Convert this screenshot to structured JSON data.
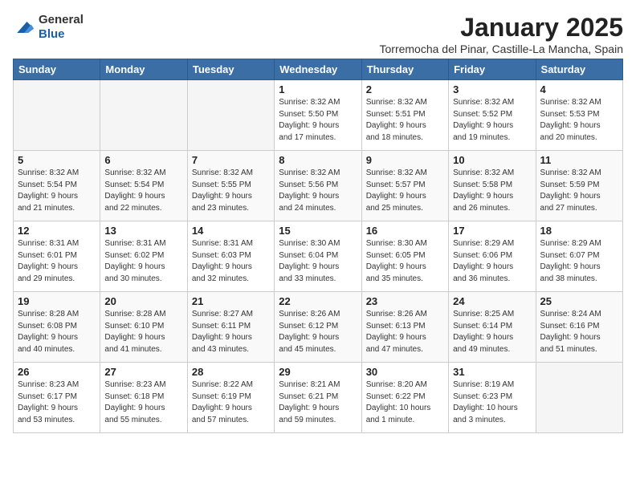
{
  "header": {
    "logo_line1": "General",
    "logo_line2": "Blue",
    "month": "January 2025",
    "location": "Torremocha del Pinar, Castille-La Mancha, Spain"
  },
  "weekdays": [
    "Sunday",
    "Monday",
    "Tuesday",
    "Wednesday",
    "Thursday",
    "Friday",
    "Saturday"
  ],
  "weeks": [
    [
      {
        "day": "",
        "info": ""
      },
      {
        "day": "",
        "info": ""
      },
      {
        "day": "",
        "info": ""
      },
      {
        "day": "1",
        "info": "Sunrise: 8:32 AM\nSunset: 5:50 PM\nDaylight: 9 hours\nand 17 minutes."
      },
      {
        "day": "2",
        "info": "Sunrise: 8:32 AM\nSunset: 5:51 PM\nDaylight: 9 hours\nand 18 minutes."
      },
      {
        "day": "3",
        "info": "Sunrise: 8:32 AM\nSunset: 5:52 PM\nDaylight: 9 hours\nand 19 minutes."
      },
      {
        "day": "4",
        "info": "Sunrise: 8:32 AM\nSunset: 5:53 PM\nDaylight: 9 hours\nand 20 minutes."
      }
    ],
    [
      {
        "day": "5",
        "info": "Sunrise: 8:32 AM\nSunset: 5:54 PM\nDaylight: 9 hours\nand 21 minutes."
      },
      {
        "day": "6",
        "info": "Sunrise: 8:32 AM\nSunset: 5:54 PM\nDaylight: 9 hours\nand 22 minutes."
      },
      {
        "day": "7",
        "info": "Sunrise: 8:32 AM\nSunset: 5:55 PM\nDaylight: 9 hours\nand 23 minutes."
      },
      {
        "day": "8",
        "info": "Sunrise: 8:32 AM\nSunset: 5:56 PM\nDaylight: 9 hours\nand 24 minutes."
      },
      {
        "day": "9",
        "info": "Sunrise: 8:32 AM\nSunset: 5:57 PM\nDaylight: 9 hours\nand 25 minutes."
      },
      {
        "day": "10",
        "info": "Sunrise: 8:32 AM\nSunset: 5:58 PM\nDaylight: 9 hours\nand 26 minutes."
      },
      {
        "day": "11",
        "info": "Sunrise: 8:32 AM\nSunset: 5:59 PM\nDaylight: 9 hours\nand 27 minutes."
      }
    ],
    [
      {
        "day": "12",
        "info": "Sunrise: 8:31 AM\nSunset: 6:01 PM\nDaylight: 9 hours\nand 29 minutes."
      },
      {
        "day": "13",
        "info": "Sunrise: 8:31 AM\nSunset: 6:02 PM\nDaylight: 9 hours\nand 30 minutes."
      },
      {
        "day": "14",
        "info": "Sunrise: 8:31 AM\nSunset: 6:03 PM\nDaylight: 9 hours\nand 32 minutes."
      },
      {
        "day": "15",
        "info": "Sunrise: 8:30 AM\nSunset: 6:04 PM\nDaylight: 9 hours\nand 33 minutes."
      },
      {
        "day": "16",
        "info": "Sunrise: 8:30 AM\nSunset: 6:05 PM\nDaylight: 9 hours\nand 35 minutes."
      },
      {
        "day": "17",
        "info": "Sunrise: 8:29 AM\nSunset: 6:06 PM\nDaylight: 9 hours\nand 36 minutes."
      },
      {
        "day": "18",
        "info": "Sunrise: 8:29 AM\nSunset: 6:07 PM\nDaylight: 9 hours\nand 38 minutes."
      }
    ],
    [
      {
        "day": "19",
        "info": "Sunrise: 8:28 AM\nSunset: 6:08 PM\nDaylight: 9 hours\nand 40 minutes."
      },
      {
        "day": "20",
        "info": "Sunrise: 8:28 AM\nSunset: 6:10 PM\nDaylight: 9 hours\nand 41 minutes."
      },
      {
        "day": "21",
        "info": "Sunrise: 8:27 AM\nSunset: 6:11 PM\nDaylight: 9 hours\nand 43 minutes."
      },
      {
        "day": "22",
        "info": "Sunrise: 8:26 AM\nSunset: 6:12 PM\nDaylight: 9 hours\nand 45 minutes."
      },
      {
        "day": "23",
        "info": "Sunrise: 8:26 AM\nSunset: 6:13 PM\nDaylight: 9 hours\nand 47 minutes."
      },
      {
        "day": "24",
        "info": "Sunrise: 8:25 AM\nSunset: 6:14 PM\nDaylight: 9 hours\nand 49 minutes."
      },
      {
        "day": "25",
        "info": "Sunrise: 8:24 AM\nSunset: 6:16 PM\nDaylight: 9 hours\nand 51 minutes."
      }
    ],
    [
      {
        "day": "26",
        "info": "Sunrise: 8:23 AM\nSunset: 6:17 PM\nDaylight: 9 hours\nand 53 minutes."
      },
      {
        "day": "27",
        "info": "Sunrise: 8:23 AM\nSunset: 6:18 PM\nDaylight: 9 hours\nand 55 minutes."
      },
      {
        "day": "28",
        "info": "Sunrise: 8:22 AM\nSunset: 6:19 PM\nDaylight: 9 hours\nand 57 minutes."
      },
      {
        "day": "29",
        "info": "Sunrise: 8:21 AM\nSunset: 6:21 PM\nDaylight: 9 hours\nand 59 minutes."
      },
      {
        "day": "30",
        "info": "Sunrise: 8:20 AM\nSunset: 6:22 PM\nDaylight: 10 hours\nand 1 minute."
      },
      {
        "day": "31",
        "info": "Sunrise: 8:19 AM\nSunset: 6:23 PM\nDaylight: 10 hours\nand 3 minutes."
      },
      {
        "day": "",
        "info": ""
      }
    ]
  ]
}
